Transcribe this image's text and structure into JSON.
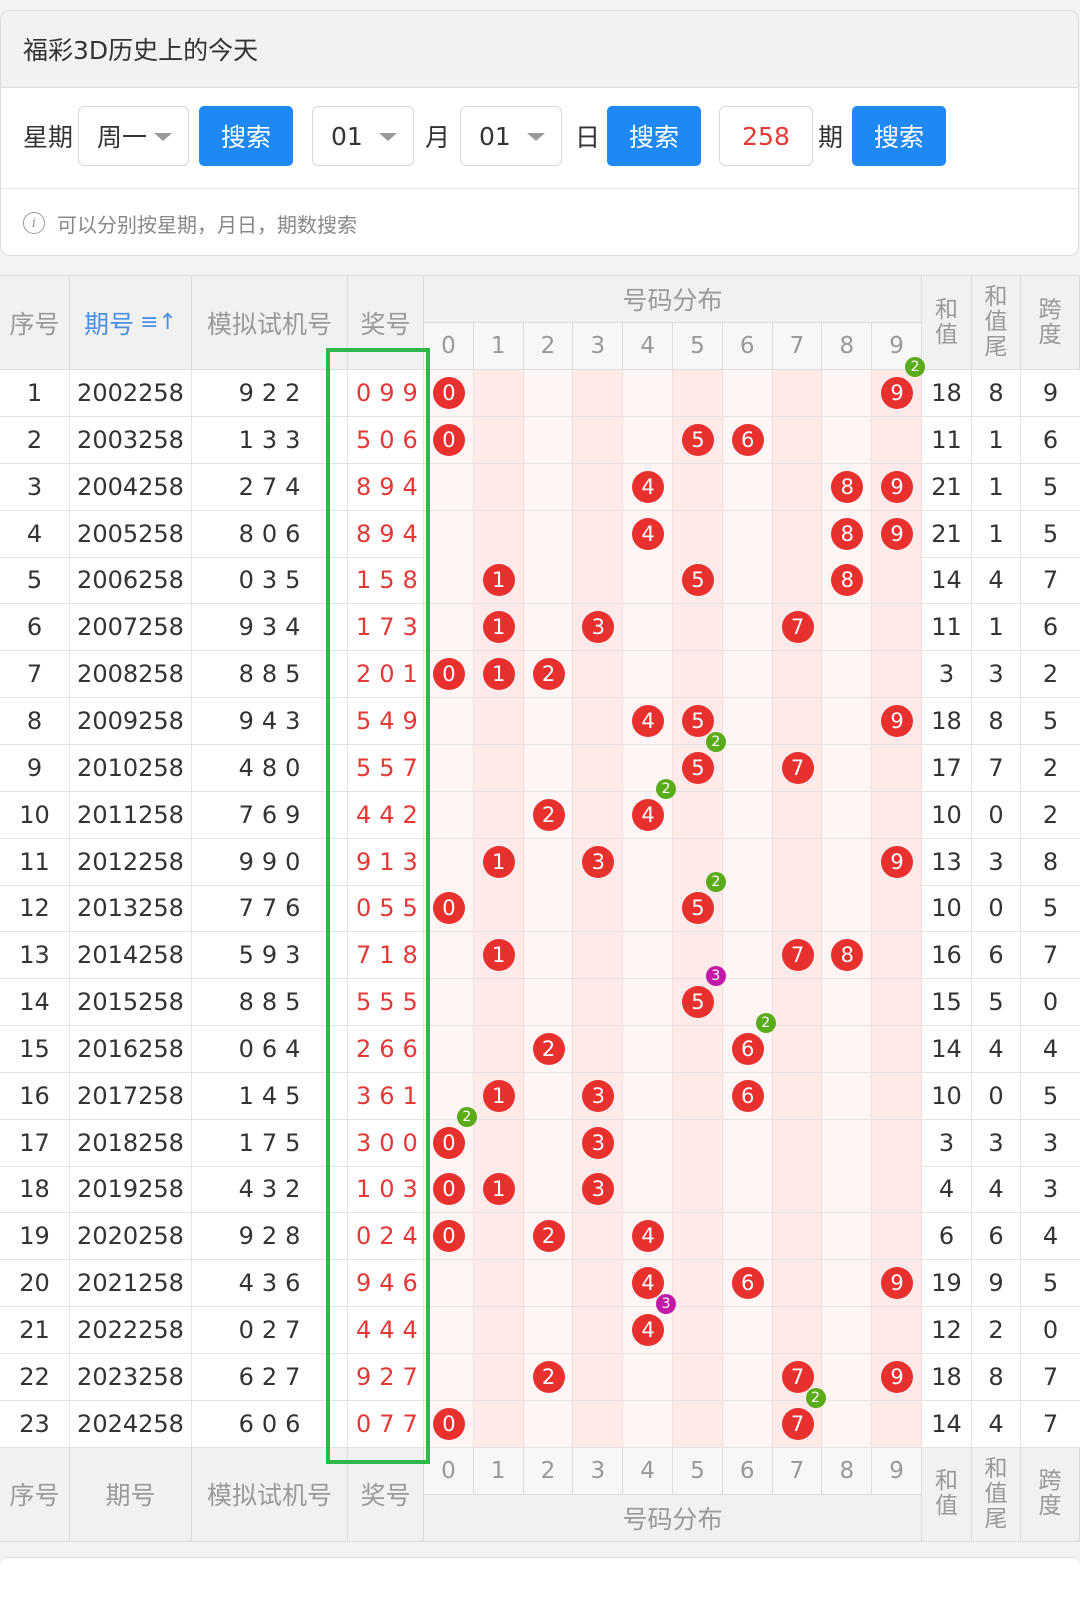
{
  "panel": {
    "title": "福彩3D历史上的今天",
    "weekday_label": "星期",
    "weekday_value": "周一",
    "search_label": "搜索",
    "month_value": "01",
    "month_label": "月",
    "day_value": "01",
    "day_label": "日",
    "issue_value": "258",
    "issue_label": "期",
    "tip": "可以分别按星期，月日，期数搜索",
    "info_icon": "i"
  },
  "table": {
    "headers": {
      "seq": "序号",
      "issue": "期号",
      "sort_icon": "≡↑",
      "sim": "模拟试机号",
      "prize": "奖号",
      "dist": "号码分布",
      "sum": "和值",
      "tail": "和值尾",
      "span": "跨度"
    },
    "digits": [
      "0",
      "1",
      "2",
      "3",
      "4",
      "5",
      "6",
      "7",
      "8",
      "9"
    ],
    "rows": [
      {
        "seq": "1",
        "issue": "2002258",
        "sim": "922",
        "prize": "099",
        "sum": "18",
        "tail": "8",
        "span": "9"
      },
      {
        "seq": "2",
        "issue": "2003258",
        "sim": "133",
        "prize": "506",
        "sum": "11",
        "tail": "1",
        "span": "6"
      },
      {
        "seq": "3",
        "issue": "2004258",
        "sim": "274",
        "prize": "894",
        "sum": "21",
        "tail": "1",
        "span": "5"
      },
      {
        "seq": "4",
        "issue": "2005258",
        "sim": "806",
        "prize": "894",
        "sum": "21",
        "tail": "1",
        "span": "5"
      },
      {
        "seq": "5",
        "issue": "2006258",
        "sim": "035",
        "prize": "158",
        "sum": "14",
        "tail": "4",
        "span": "7"
      },
      {
        "seq": "6",
        "issue": "2007258",
        "sim": "934",
        "prize": "173",
        "sum": "11",
        "tail": "1",
        "span": "6"
      },
      {
        "seq": "7",
        "issue": "2008258",
        "sim": "885",
        "prize": "201",
        "sum": "3",
        "tail": "3",
        "span": "2"
      },
      {
        "seq": "8",
        "issue": "2009258",
        "sim": "943",
        "prize": "549",
        "sum": "18",
        "tail": "8",
        "span": "5"
      },
      {
        "seq": "9",
        "issue": "2010258",
        "sim": "480",
        "prize": "557",
        "sum": "17",
        "tail": "7",
        "span": "2"
      },
      {
        "seq": "10",
        "issue": "2011258",
        "sim": "769",
        "prize": "442",
        "sum": "10",
        "tail": "0",
        "span": "2"
      },
      {
        "seq": "11",
        "issue": "2012258",
        "sim": "990",
        "prize": "913",
        "sum": "13",
        "tail": "3",
        "span": "8"
      },
      {
        "seq": "12",
        "issue": "2013258",
        "sim": "776",
        "prize": "055",
        "sum": "10",
        "tail": "0",
        "span": "5"
      },
      {
        "seq": "13",
        "issue": "2014258",
        "sim": "593",
        "prize": "718",
        "sum": "16",
        "tail": "6",
        "span": "7"
      },
      {
        "seq": "14",
        "issue": "2015258",
        "sim": "885",
        "prize": "555",
        "sum": "15",
        "tail": "5",
        "span": "0"
      },
      {
        "seq": "15",
        "issue": "2016258",
        "sim": "064",
        "prize": "266",
        "sum": "14",
        "tail": "4",
        "span": "4"
      },
      {
        "seq": "16",
        "issue": "2017258",
        "sim": "145",
        "prize": "361",
        "sum": "10",
        "tail": "0",
        "span": "5"
      },
      {
        "seq": "17",
        "issue": "2018258",
        "sim": "175",
        "prize": "300",
        "sum": "3",
        "tail": "3",
        "span": "3"
      },
      {
        "seq": "18",
        "issue": "2019258",
        "sim": "432",
        "prize": "103",
        "sum": "4",
        "tail": "4",
        "span": "3"
      },
      {
        "seq": "19",
        "issue": "2020258",
        "sim": "928",
        "prize": "024",
        "sum": "6",
        "tail": "6",
        "span": "4"
      },
      {
        "seq": "20",
        "issue": "2021258",
        "sim": "436",
        "prize": "946",
        "sum": "19",
        "tail": "9",
        "span": "5"
      },
      {
        "seq": "21",
        "issue": "2022258",
        "sim": "027",
        "prize": "444",
        "sum": "12",
        "tail": "2",
        "span": "0"
      },
      {
        "seq": "22",
        "issue": "2023258",
        "sim": "627",
        "prize": "927",
        "sum": "18",
        "tail": "8",
        "span": "7"
      },
      {
        "seq": "23",
        "issue": "2024258",
        "sim": "606",
        "prize": "077",
        "sum": "14",
        "tail": "4",
        "span": "7"
      }
    ]
  },
  "colors": {
    "ball": "#e8302f",
    "double_badge": "#5aac1b",
    "triple_badge": "#c21aa8",
    "highlight_box": "#2eb84a",
    "button": "#1e88f5"
  }
}
